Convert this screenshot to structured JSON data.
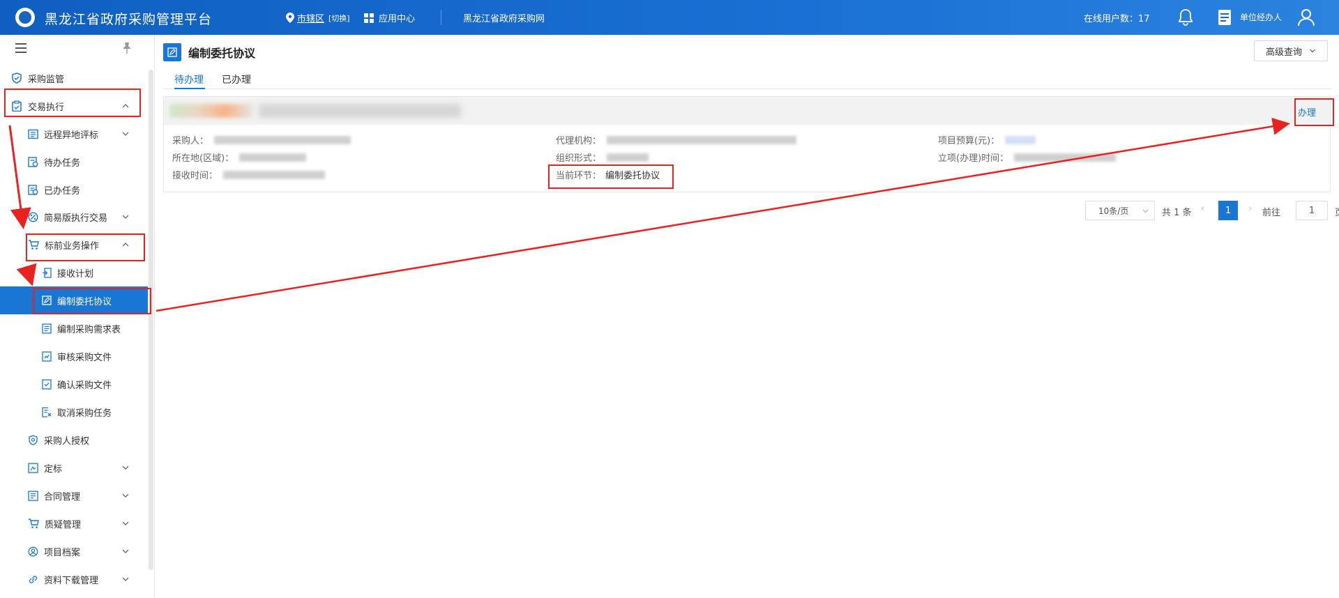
{
  "header": {
    "title": "黑龙江省政府采购管理平台",
    "region": "市辖区",
    "switch": "[切换]",
    "app_center": "应用中心",
    "procurement_net": "黑龙江省政府采购网",
    "online_users": "在线用户数：17",
    "unit_manager": "单位经办人"
  },
  "sidebar": {
    "items": [
      {
        "label": "采购监管",
        "icon": "shield-icon"
      },
      {
        "label": "交易执行",
        "icon": "clipboard-icon"
      },
      {
        "label": "远程异地评标",
        "icon": "list-icon"
      },
      {
        "label": "待办任务",
        "icon": "todo-icon"
      },
      {
        "label": "已办任务",
        "icon": "done-icon"
      },
      {
        "label": "简易版执行交易",
        "icon": "percent-icon"
      },
      {
        "label": "标前业务操作",
        "icon": "cart-icon"
      },
      {
        "label": "接收计划",
        "icon": "receive-icon"
      },
      {
        "label": "编制委托协议",
        "icon": "edit-icon"
      },
      {
        "label": "编制采购需求表",
        "icon": "form-icon"
      },
      {
        "label": "审核采购文件",
        "icon": "audit-icon"
      },
      {
        "label": "确认采购文件",
        "icon": "check-file-icon"
      },
      {
        "label": "取消采购任务",
        "icon": "cancel-icon"
      },
      {
        "label": "采购人授权",
        "icon": "auth-icon"
      },
      {
        "label": "定标",
        "icon": "award-icon"
      },
      {
        "label": "合同管理",
        "icon": "contract-icon"
      },
      {
        "label": "质疑管理",
        "icon": "cart-icon"
      },
      {
        "label": "项目档案",
        "icon": "user-circle-icon"
      },
      {
        "label": "资料下载管理",
        "icon": "link-icon"
      }
    ]
  },
  "main": {
    "title": "编制委托协议",
    "advanced_search": "高级查询",
    "tabs": [
      "待办理",
      "已办理"
    ],
    "record": {
      "handle": "办理",
      "purchaser_label": "采购人：",
      "agency_label": "代理机构：",
      "budget_label": "项目预算(元)：",
      "location_label": "所在地(区域)：",
      "org_form_label": "组织形式：",
      "project_time_label": "立项(办理)时间：",
      "receive_time_label": "接收时间：",
      "current_step_label": "当前环节：",
      "current_step_value": "编制委托协议"
    },
    "pagination": {
      "page_size": "10条/页",
      "total": "共 1 条",
      "current_page": "1",
      "goto_label": "前往",
      "goto_value": "1",
      "page_unit": "页"
    }
  },
  "colors": {
    "primary": "#1976d2",
    "header": "#1466c9",
    "annotation": "#e8231f"
  }
}
